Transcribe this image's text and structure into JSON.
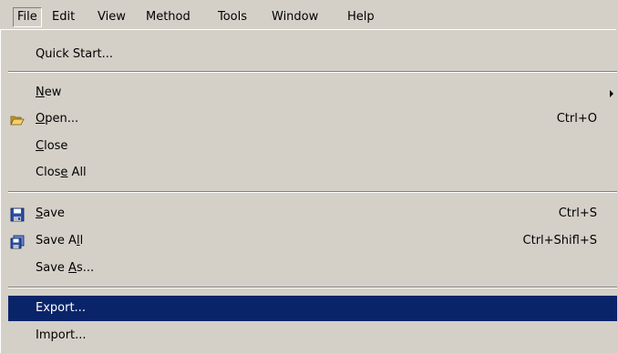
{
  "menubar": {
    "items": [
      "File",
      "Edit",
      "View",
      "Method",
      "Tools",
      "Window",
      "Help"
    ],
    "active": "File"
  },
  "menu": {
    "quick_start": {
      "label": "Quick Start..."
    },
    "new": {
      "label_access": "N",
      "label_rest": "ew"
    },
    "open": {
      "label_access": "O",
      "label_rest": "pen...",
      "shortcut": "Ctrl+O",
      "icon": "open-folder-icon"
    },
    "close": {
      "label_access": "C",
      "label_rest": "lose"
    },
    "close_all": {
      "label_pre": "Clos",
      "label_access": "e",
      "label_rest": " All"
    },
    "save": {
      "label_access": "S",
      "label_rest": "ave",
      "shortcut": "Ctrl+S",
      "icon": "floppy-disk-icon"
    },
    "save_all": {
      "label_pre": "Save A",
      "label_access": "l",
      "label_rest": "l",
      "shortcut": "Ctrl+Shifl+S",
      "icon": "save-all-icon"
    },
    "save_as": {
      "label_pre": "Save ",
      "label_access": "A",
      "label_rest": "s...",
      "shortcut": ""
    },
    "export": {
      "label": "Export..."
    },
    "import": {
      "label": "Import..."
    }
  },
  "colors": {
    "menu_bg": "#d4d0c8",
    "highlight_bg": "#0a246a",
    "highlight_fg": "#ffffff"
  }
}
